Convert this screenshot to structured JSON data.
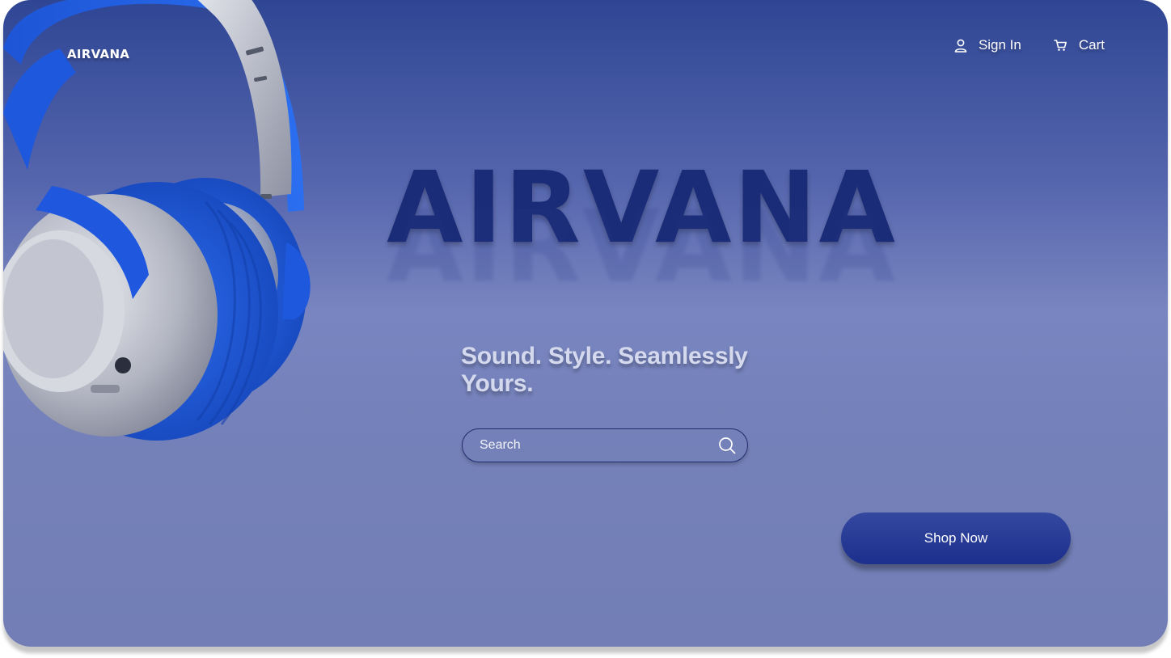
{
  "brand": {
    "logo_text": "AIRVANA"
  },
  "nav": {
    "sign_in_label": "Sign In",
    "cart_label": "Cart",
    "sign_in_icon": "user-icon",
    "cart_icon": "cart-icon"
  },
  "hero": {
    "title": "AIRVANA",
    "tagline": "Sound. Style. Seamlessly Yours.",
    "image": "blue-headphones"
  },
  "search": {
    "placeholder": "Search",
    "value": "",
    "icon": "search-icon"
  },
  "cta": {
    "label": "Shop Now"
  },
  "colors": {
    "background_top": "#2f4694",
    "background_bottom": "#727eb5",
    "title": "#1a2c78",
    "button": "#1c2f8c",
    "headphone_blue": "#1f5fe0",
    "headphone_silver": "#c4c7d2"
  }
}
